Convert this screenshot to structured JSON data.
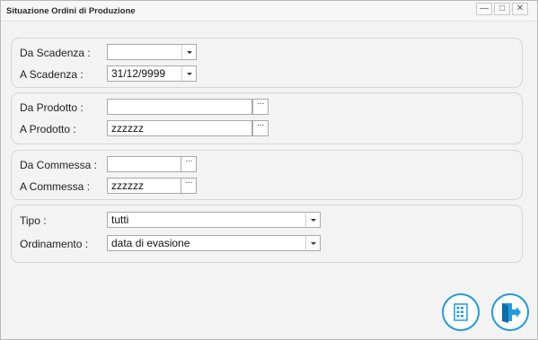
{
  "window": {
    "title": "Situazione Ordini di Produzione",
    "controls": [
      "minimize-icon",
      "maximize-icon",
      "close-icon"
    ]
  },
  "scadenza": {
    "from_label": "Da Scadenza :",
    "from_value": "",
    "to_label": "A Scadenza :",
    "to_value": "31/12/9999"
  },
  "prodotto": {
    "from_label": "Da Prodotto :",
    "from_value": "",
    "to_label": "A Prodotto :",
    "to_value": "zzzzzz"
  },
  "commessa": {
    "from_label": "Da Commessa :",
    "from_value": "",
    "to_label": "A Commessa :",
    "to_value": "zzzzzz"
  },
  "options": {
    "tipo_label": "Tipo :",
    "tipo_value": "tutti",
    "ordinamento_label": "Ordinamento :",
    "ordinamento_value": "data di evasione"
  },
  "buttons": {
    "dots": "···",
    "report_icon": "grid-report-icon",
    "exit_icon": "exit-door-icon"
  },
  "colors": {
    "accent": "#1f9be0"
  }
}
